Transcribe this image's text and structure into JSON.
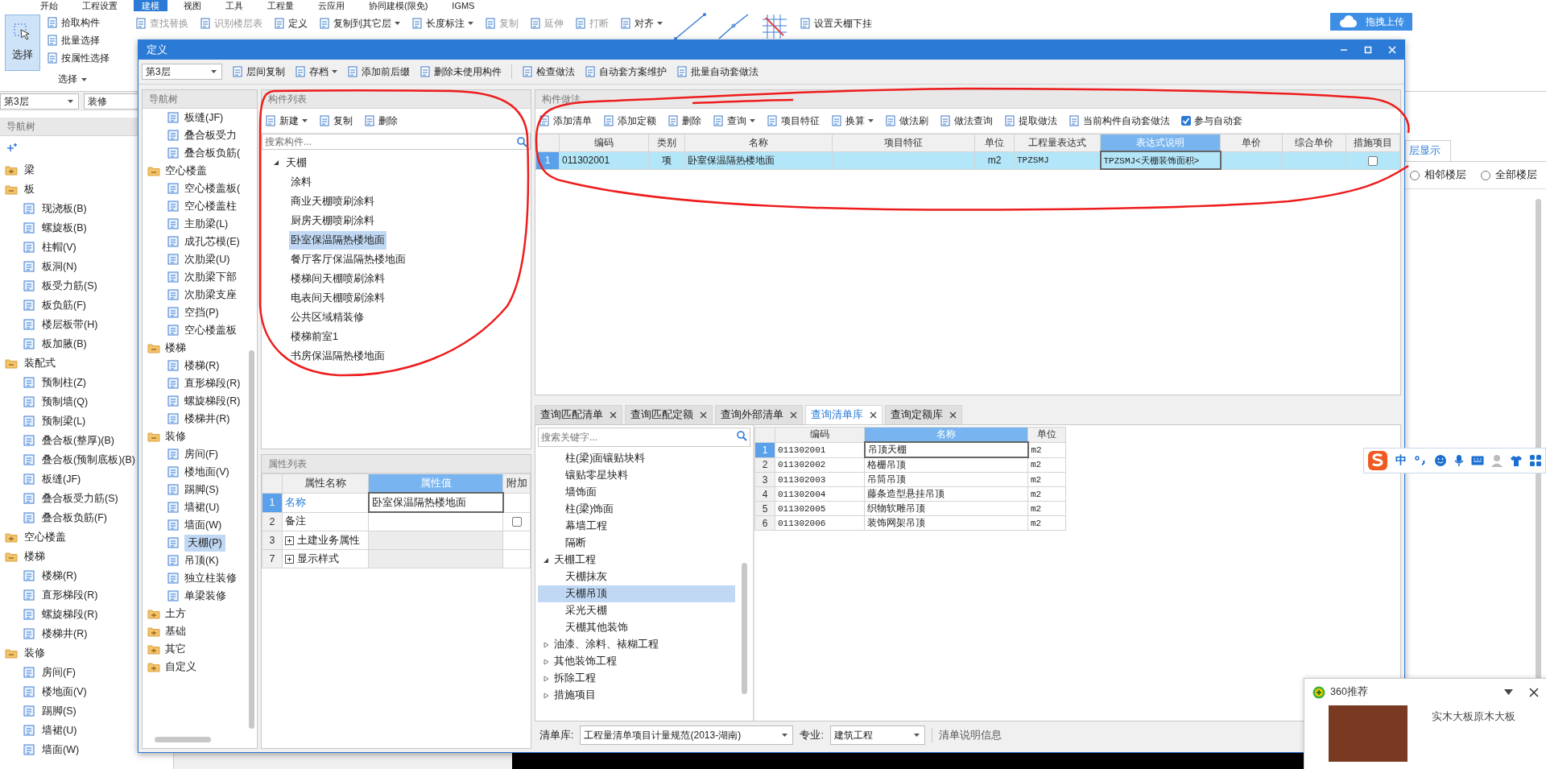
{
  "ribbon_tabs": [
    {
      "label": "开始",
      "selected": false
    },
    {
      "label": "工程设置",
      "selected": false
    },
    {
      "label": "建模",
      "selected": true
    },
    {
      "label": "视图",
      "selected": false
    },
    {
      "label": "工具",
      "selected": false
    },
    {
      "label": "工程量",
      "selected": false
    },
    {
      "label": "云应用",
      "selected": false
    },
    {
      "label": "协同建模(限免)",
      "selected": false
    },
    {
      "label": "IGMS",
      "selected": false
    }
  ],
  "ribbon": {
    "select_button": {
      "label": "选择",
      "selected": true
    },
    "select_tools": [
      {
        "label": "拾取构件"
      },
      {
        "label": "批量选择"
      },
      {
        "label": "按属性选择"
      }
    ],
    "group_label": "选择",
    "tools": [
      {
        "label": "查找替换",
        "disabled": true,
        "dropdown": false
      },
      {
        "label": "识别楼层表",
        "disabled": true,
        "dropdown": false
      },
      {
        "label": "定义",
        "disabled": false,
        "dropdown": false
      },
      {
        "label": "复制到其它层",
        "disabled": false,
        "dropdown": true
      },
      {
        "label": "长度标注",
        "disabled": false,
        "dropdown": true
      },
      {
        "label": "复制",
        "disabled": true,
        "dropdown": false
      },
      {
        "label": "延伸",
        "disabled": true,
        "dropdown": false
      },
      {
        "label": "打断",
        "disabled": true,
        "dropdown": false
      },
      {
        "label": "对齐",
        "disabled": false,
        "dropdown": true
      }
    ],
    "ceiling_tool": "设置天棚下挂",
    "upload_button": "拖拽上传"
  },
  "left_panel": {
    "floor": "第3层",
    "category": "装修",
    "header": "导航树",
    "tree": [
      {
        "label": "梁",
        "expanded": false
      },
      {
        "label": "板",
        "expanded": true,
        "children": [
          {
            "label": "现浇板(B)",
            "selected": false
          },
          {
            "label": "螺旋板(B)",
            "selected": false
          },
          {
            "label": "柱帽(V)",
            "selected": false
          },
          {
            "label": "板洞(N)",
            "selected": false
          },
          {
            "label": "板受力筋(S)",
            "selected": false
          },
          {
            "label": "板负筋(F)",
            "selected": false
          },
          {
            "label": "楼层板带(H)",
            "selected": false
          },
          {
            "label": "板加腋(B)",
            "selected": false
          }
        ]
      },
      {
        "label": "装配式",
        "expanded": true,
        "children": [
          {
            "label": "预制柱(Z)",
            "selected": false
          },
          {
            "label": "预制墙(Q)",
            "selected": false
          },
          {
            "label": "预制梁(L)",
            "selected": false
          },
          {
            "label": "叠合板(整厚)(B)",
            "selected": false
          },
          {
            "label": "叠合板(预制底板)(B)",
            "selected": false
          },
          {
            "label": "板缝(JF)",
            "selected": false
          },
          {
            "label": "叠合板受力筋(S)",
            "selected": false
          },
          {
            "label": "叠合板负筋(F)",
            "selected": false
          }
        ]
      },
      {
        "label": "空心楼盖",
        "expanded": false
      },
      {
        "label": "楼梯",
        "expanded": true,
        "children": [
          {
            "label": "楼梯(R)",
            "selected": false
          },
          {
            "label": "直形梯段(R)",
            "selected": false
          },
          {
            "label": "螺旋梯段(R)",
            "selected": false
          },
          {
            "label": "楼梯井(R)",
            "selected": false
          }
        ]
      },
      {
        "label": "装修",
        "expanded": true,
        "children": [
          {
            "label": "房间(F)",
            "selected": false
          },
          {
            "label": "楼地面(V)",
            "selected": false
          },
          {
            "label": "踢脚(S)",
            "selected": false
          },
          {
            "label": "墙裙(U)",
            "selected": false
          },
          {
            "label": "墙面(W)",
            "selected": false
          }
        ]
      }
    ]
  },
  "layer_panel": {
    "tab": "层显示",
    "options": [
      {
        "label": "相邻楼层",
        "selected": false
      },
      {
        "label": "全部楼层",
        "selected": false
      }
    ]
  },
  "dialog": {
    "title": "定义",
    "floor": "第3层",
    "toolbar": [
      {
        "label": "层间复制",
        "dropdown": false
      },
      {
        "label": "存档",
        "dropdown": true
      },
      {
        "label": "添加前后缀",
        "dropdown": false
      },
      {
        "label": "删除未使用构件",
        "dropdown": false
      },
      {
        "label": "检查做法",
        "dropdown": false
      },
      {
        "label": "自动套方案维护",
        "dropdown": false
      },
      {
        "label": "批量自动套做法",
        "dropdown": false
      }
    ],
    "nav": {
      "header": "导航树",
      "tree": [
        {
          "children": [
            {
              "label": "板缝(JF)",
              "selected": false
            },
            {
              "label": "叠合板受力",
              "selected": false
            },
            {
              "label": "叠合板负筋(",
              "selected": false
            }
          ]
        },
        {
          "label": "空心楼盖",
          "expanded": true,
          "children": [
            {
              "label": "空心楼盖板(",
              "selected": false
            },
            {
              "label": "空心楼盖柱",
              "selected": false
            },
            {
              "label": "主肋梁(L)",
              "selected": false
            },
            {
              "label": "成孔芯模(E)",
              "selected": false
            },
            {
              "label": "次肋梁(U)",
              "selected": false
            },
            {
              "label": "次肋梁下部",
              "selected": false
            },
            {
              "label": "次肋梁支座",
              "selected": false
            },
            {
              "label": "空挡(P)",
              "selected": false
            },
            {
              "label": "空心楼盖板",
              "selected": false
            }
          ]
        },
        {
          "label": "楼梯",
          "expanded": true,
          "children": [
            {
              "label": "楼梯(R)",
              "selected": false
            },
            {
              "label": "直形梯段(R)",
              "selected": false
            },
            {
              "label": "螺旋梯段(R)",
              "selected": false
            },
            {
              "label": "楼梯井(R)",
              "selected": false
            }
          ]
        },
        {
          "label": "装修",
          "expanded": true,
          "children": [
            {
              "label": "房间(F)",
              "selected": false
            },
            {
              "label": "楼地面(V)",
              "selected": false
            },
            {
              "label": "踢脚(S)",
              "selected": false
            },
            {
              "label": "墙裙(U)",
              "selected": false
            },
            {
              "label": "墙面(W)",
              "selected": false
            },
            {
              "label": "天棚(P)",
              "selected": true
            },
            {
              "label": "吊顶(K)",
              "selected": false
            },
            {
              "label": "独立柱装修",
              "selected": false
            },
            {
              "label": "单梁装修",
              "selected": false
            }
          ]
        },
        {
          "label": "土方",
          "expanded": false
        },
        {
          "label": "基础",
          "expanded": false
        },
        {
          "label": "其它",
          "expanded": false
        },
        {
          "label": "自定义",
          "expanded": false
        }
      ]
    },
    "components": {
      "header": "构件列表",
      "toolbar": [
        {
          "label": "新建",
          "dropdown": true
        },
        {
          "label": "复制",
          "dropdown": false
        },
        {
          "label": "删除",
          "dropdown": false
        }
      ],
      "search_placeholder": "搜索构件...",
      "tree": [
        {
          "label": "天棚",
          "expanded": true,
          "children": [
            {
              "label": "涂料",
              "selected": false
            },
            {
              "label": "商业天棚喷刷涂料",
              "selected": false
            },
            {
              "label": "厨房天棚喷刷涂料",
              "selected": false
            },
            {
              "label": "卧室保温隔热楼地面",
              "selected": true
            },
            {
              "label": "餐厅客厅保温隔热楼地面",
              "selected": false
            },
            {
              "label": "楼梯间天棚喷刷涂料",
              "selected": false
            },
            {
              "label": "电表间天棚喷刷涂料",
              "selected": false
            },
            {
              "label": "公共区域精装修",
              "selected": false
            },
            {
              "label": "楼梯前室1",
              "selected": false
            },
            {
              "label": "书房保温隔热楼地面",
              "selected": false
            }
          ]
        }
      ]
    },
    "properties": {
      "header": "属性列表",
      "columns": [
        {
          "label": "属性名称",
          "selected": false
        },
        {
          "label": "属性值",
          "selected": true
        },
        {
          "label": "附加",
          "selected": false
        }
      ],
      "rows": [
        {
          "num": "1",
          "name": "名称",
          "value": "卧室保温隔热楼地面",
          "kind": "field",
          "selected": true
        },
        {
          "num": "2",
          "name": "备注",
          "kind": "check",
          "checked": false,
          "selected": false
        },
        {
          "num": "3",
          "name": "土建业务属性",
          "kind": "group",
          "selected": false
        },
        {
          "num": "7",
          "name": "显示样式",
          "kind": "group",
          "selected": false
        }
      ]
    },
    "methods": {
      "header": "构件做法",
      "toolbar": [
        {
          "label": "添加清单",
          "dropdown": false
        },
        {
          "label": "添加定额",
          "dropdown": false
        },
        {
          "label": "删除",
          "dropdown": false
        },
        {
          "label": "查询",
          "dropdown": true
        },
        {
          "label": "项目特征",
          "dropdown": false
        },
        {
          "label": "换算",
          "dropdown": true
        },
        {
          "label": "做法刷",
          "dropdown": false
        },
        {
          "label": "做法查询",
          "dropdown": false
        },
        {
          "label": "提取做法",
          "dropdown": false
        },
        {
          "label": "当前构件自动套做法",
          "dropdown": false
        }
      ],
      "auto_match": {
        "label": "参与自动套",
        "checked": true
      },
      "columns": [
        {
          "label": "编码",
          "selected": false
        },
        {
          "label": "类别",
          "selected": false
        },
        {
          "label": "名称",
          "selected": false
        },
        {
          "label": "项目特征",
          "selected": false
        },
        {
          "label": "单位",
          "selected": false
        },
        {
          "label": "工程量表达式",
          "selected": false
        },
        {
          "label": "表达式说明",
          "selected": true
        },
        {
          "label": "单价",
          "selected": false
        },
        {
          "label": "综合单价",
          "selected": false
        },
        {
          "label": "措施项目",
          "selected": false
        }
      ],
      "rows": [
        {
          "num": "1",
          "selected": true,
          "cells": [
            "011302001",
            "项",
            "卧室保温隔热楼地面",
            "",
            "m2",
            "TPZSMJ",
            "TPZSMJ<天棚装饰面积>",
            "",
            ""
          ],
          "measure": false
        }
      ]
    },
    "query": {
      "tabs": [
        {
          "label": "查询匹配清单",
          "selected": false
        },
        {
          "label": "查询匹配定额",
          "selected": false
        },
        {
          "label": "查询外部清单",
          "selected": false
        },
        {
          "label": "查询清单库",
          "selected": true
        },
        {
          "label": "查询定额库",
          "selected": false
        }
      ],
      "search_placeholder": "搜索关键字...",
      "tree": [
        {
          "children": [
            {
              "label": "柱(梁)面镶贴块料",
              "selected": false
            },
            {
              "label": "镶贴零星块料",
              "selected": false
            },
            {
              "label": "墙饰面",
              "selected": false
            },
            {
              "label": "柱(梁)饰面",
              "selected": false
            },
            {
              "label": "幕墙工程",
              "selected": false
            },
            {
              "label": "隔断",
              "selected": false
            }
          ]
        },
        {
          "label": "天棚工程",
          "expanded": true,
          "children": [
            {
              "label": "天棚抹灰",
              "selected": false
            },
            {
              "label": "天棚吊顶",
              "selected": true
            },
            {
              "label": "采光天棚",
              "selected": false
            },
            {
              "label": "天棚其他装饰",
              "selected": false
            }
          ]
        },
        {
          "label": "油漆、涂料、裱糊工程",
          "expanded": false
        },
        {
          "label": "其他装饰工程",
          "expanded": false
        },
        {
          "label": "拆除工程",
          "expanded": false
        },
        {
          "label": "措施项目",
          "expanded": false
        }
      ],
      "columns": [
        {
          "label": "编码",
          "selected": false
        },
        {
          "label": "名称",
          "selected": true
        },
        {
          "label": "单位",
          "selected": false
        }
      ],
      "rows": [
        {
          "num": "1",
          "selected": true,
          "cells": [
            "011302001",
            "吊顶天棚",
            "m2"
          ]
        },
        {
          "num": "2",
          "selected": false,
          "cells": [
            "011302002",
            "格栅吊顶",
            "m2"
          ]
        },
        {
          "num": "3",
          "selected": false,
          "cells": [
            "011302003",
            "吊筒吊顶",
            "m2"
          ]
        },
        {
          "num": "4",
          "selected": false,
          "cells": [
            "011302004",
            "藤条造型悬挂吊顶",
            "m2"
          ]
        },
        {
          "num": "5",
          "selected": false,
          "cells": [
            "011302005",
            "织物软雕吊顶",
            "m2"
          ]
        },
        {
          "num": "6",
          "selected": false,
          "cells": [
            "011302006",
            "装饰网架吊顶",
            "m2"
          ]
        }
      ],
      "footer": {
        "library_label": "清单库:",
        "library": "工程量清单项目计量规范(2013-湖南)",
        "specialty_label": "专业:",
        "specialty": "建筑工程",
        "info": "清单说明信息"
      }
    }
  },
  "ime_toolbar": {
    "mode": "中"
  },
  "popup": {
    "title": "360推荐",
    "caption": "实木大板原木大板"
  }
}
